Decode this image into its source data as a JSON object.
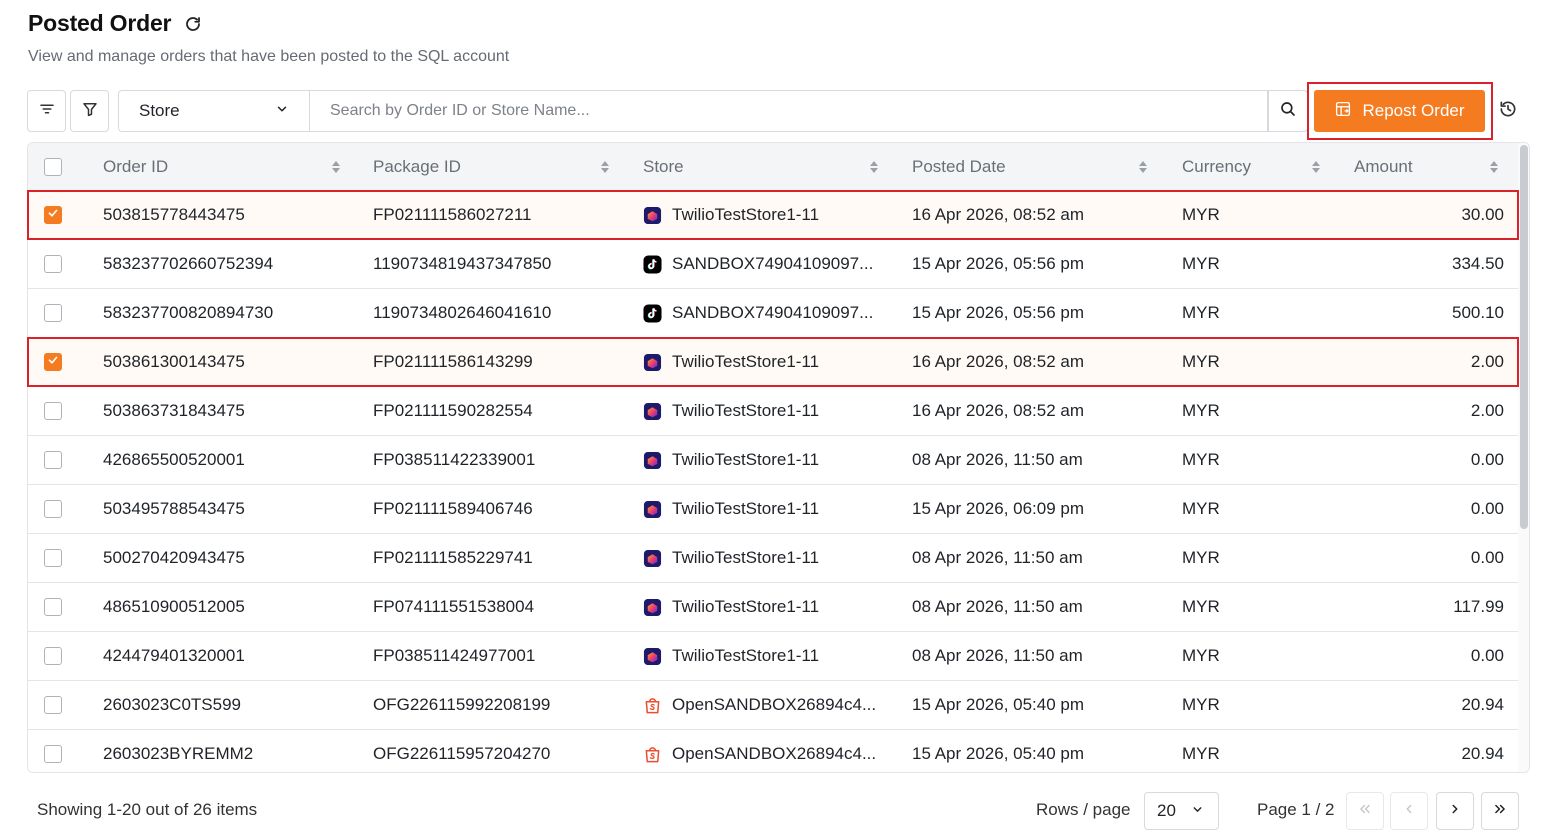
{
  "header": {
    "title": "Posted Order",
    "subtitle": "View and manage orders that have been posted to the SQL account"
  },
  "toolbar": {
    "store_label": "Store",
    "search_placeholder": "Search by Order ID or Store Name...",
    "repost_label": "Repost Order"
  },
  "table": {
    "columns": [
      "Order ID",
      "Package ID",
      "Store",
      "Posted Date",
      "Currency",
      "Amount"
    ],
    "rows": [
      {
        "order_id": "503815778443475",
        "package_id": "FP021111586027211",
        "store": "TwilioTestStore1-11",
        "store_icon": "lazada-icon",
        "posted_date": "16 Apr 2026, 08:52 am",
        "currency": "MYR",
        "amount": "30.00",
        "checked": true
      },
      {
        "order_id": "583237702660752394",
        "package_id": "1190734819437347850",
        "store": "SANDBOX74904109097...",
        "store_icon": "tiktok-icon",
        "posted_date": "15 Apr 2026, 05:56 pm",
        "currency": "MYR",
        "amount": "334.50",
        "checked": false
      },
      {
        "order_id": "583237700820894730",
        "package_id": "1190734802646041610",
        "store": "SANDBOX74904109097...",
        "store_icon": "tiktok-icon",
        "posted_date": "15 Apr 2026, 05:56 pm",
        "currency": "MYR",
        "amount": "500.10",
        "checked": false
      },
      {
        "order_id": "503861300143475",
        "package_id": "FP021111586143299",
        "store": "TwilioTestStore1-11",
        "store_icon": "lazada-icon",
        "posted_date": "16 Apr 2026, 08:52 am",
        "currency": "MYR",
        "amount": "2.00",
        "checked": true
      },
      {
        "order_id": "503863731843475",
        "package_id": "FP021111590282554",
        "store": "TwilioTestStore1-11",
        "store_icon": "lazada-icon",
        "posted_date": "16 Apr 2026, 08:52 am",
        "currency": "MYR",
        "amount": "2.00",
        "checked": false
      },
      {
        "order_id": "426865500520001",
        "package_id": "FP038511422339001",
        "store": "TwilioTestStore1-11",
        "store_icon": "lazada-icon",
        "posted_date": "08 Apr 2026, 11:50 am",
        "currency": "MYR",
        "amount": "0.00",
        "checked": false
      },
      {
        "order_id": "503495788543475",
        "package_id": "FP021111589406746",
        "store": "TwilioTestStore1-11",
        "store_icon": "lazada-icon",
        "posted_date": "15 Apr 2026, 06:09 pm",
        "currency": "MYR",
        "amount": "0.00",
        "checked": false
      },
      {
        "order_id": "500270420943475",
        "package_id": "FP021111585229741",
        "store": "TwilioTestStore1-11",
        "store_icon": "lazada-icon",
        "posted_date": "08 Apr 2026, 11:50 am",
        "currency": "MYR",
        "amount": "0.00",
        "checked": false
      },
      {
        "order_id": "486510900512005",
        "package_id": "FP074111551538004",
        "store": "TwilioTestStore1-11",
        "store_icon": "lazada-icon",
        "posted_date": "08 Apr 2026, 11:50 am",
        "currency": "MYR",
        "amount": "117.99",
        "checked": false
      },
      {
        "order_id": "424479401320001",
        "package_id": "FP038511424977001",
        "store": "TwilioTestStore1-11",
        "store_icon": "lazada-icon",
        "posted_date": "08 Apr 2026, 11:50 am",
        "currency": "MYR",
        "amount": "0.00",
        "checked": false
      },
      {
        "order_id": "2603023C0TS599",
        "package_id": "OFG226115992208199",
        "store": "OpenSANDBOX26894c4...",
        "store_icon": "shopee-icon",
        "posted_date": "15 Apr 2026, 05:40 pm",
        "currency": "MYR",
        "amount": "20.94",
        "checked": false
      },
      {
        "order_id": "2603023BYREMM2",
        "package_id": "OFG226115957204270",
        "store": "OpenSANDBOX26894c4...",
        "store_icon": "shopee-icon",
        "posted_date": "15 Apr 2026, 05:40 pm",
        "currency": "MYR",
        "amount": "20.94",
        "checked": false
      }
    ]
  },
  "footer": {
    "showing": "Showing 1-20 out of 26 items",
    "rows_label": "Rows / page",
    "rows_value": "20",
    "page_label": "Page 1 / 2"
  },
  "colors": {
    "accent": "#f47b20",
    "highlight": "#d9222a",
    "lazada": "#5a2ee0",
    "tiktok": "#000000",
    "shopee": "#ee4d2d"
  }
}
